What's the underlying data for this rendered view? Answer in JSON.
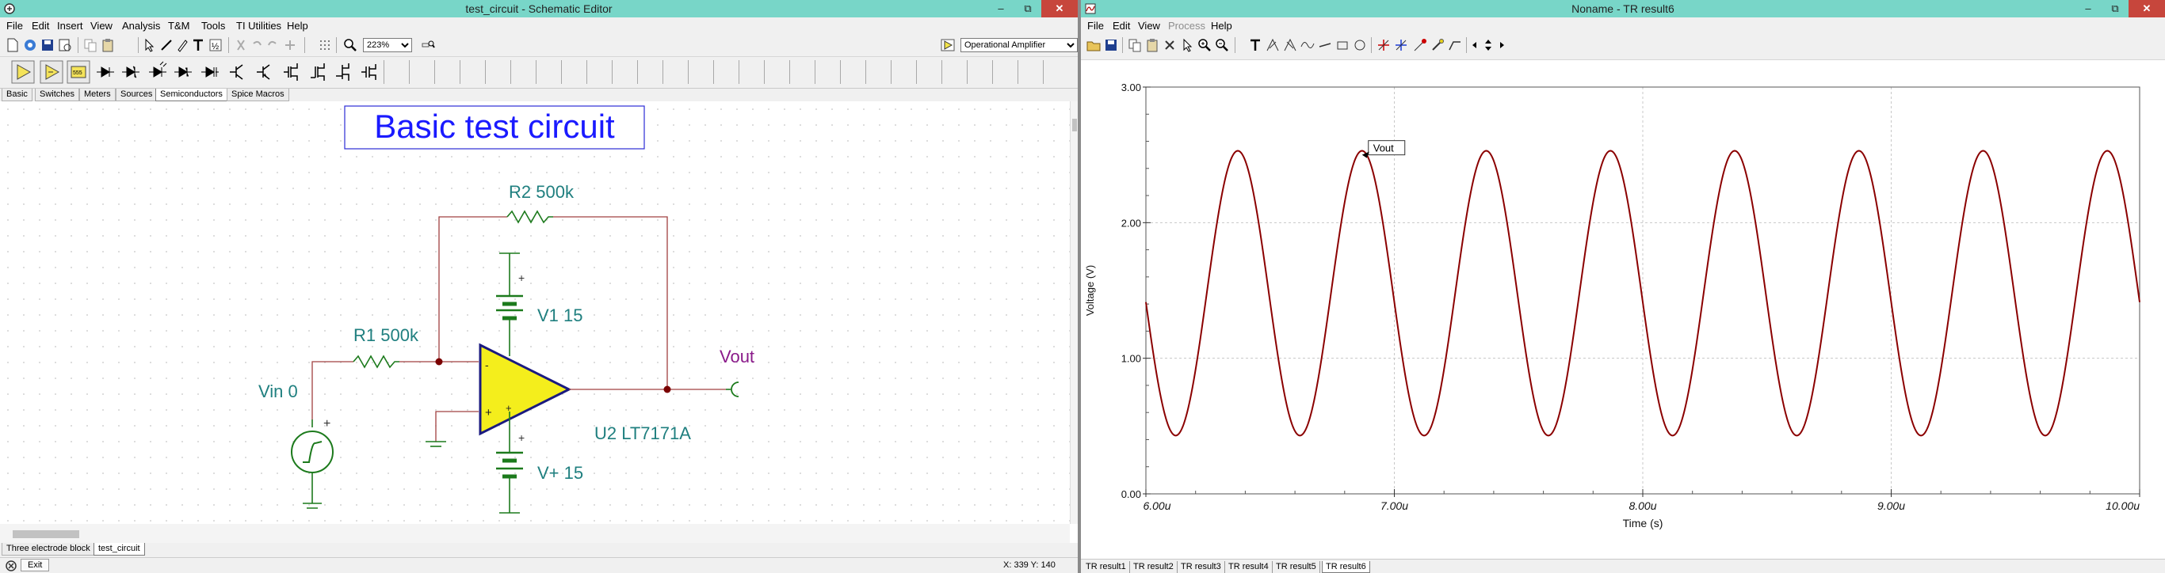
{
  "left": {
    "title": "test_circuit - Schematic Editor",
    "menu": [
      "File",
      "Edit",
      "Insert",
      "View",
      "Analysis",
      "T&M",
      "Tools",
      "TI Utilities",
      "Help"
    ],
    "zoom": "223%",
    "part_selector": "Operational Amplifier",
    "part_tabs": [
      "Basic",
      "Switches",
      "Meters",
      "Sources",
      "Semiconductors",
      "Spice Macros"
    ],
    "active_part_tab": "Semiconductors",
    "schematic": {
      "title": "Basic test circuit",
      "r2": "R2 500k",
      "r1": "R1 500k",
      "v1": "V1 15",
      "vplus": "V+ 15",
      "vin": "Vin 0",
      "vout": "Vout",
      "u2": "U2 LT7171A",
      "plus": "+",
      "minus": "-"
    },
    "doc_tabs": [
      "Three electrode block",
      "test_circuit"
    ],
    "status": {
      "exit_label": "Exit",
      "coords": "X: 339 Y: 140"
    }
  },
  "right": {
    "title": "Noname - TR result6",
    "menu": [
      "File",
      "Edit",
      "View",
      "Process",
      "Help"
    ],
    "menu_disabled": [
      "Process"
    ],
    "result_tabs": [
      "TR result1",
      "TR result2",
      "TR result3",
      "TR result4",
      "TR result5",
      "TR result6"
    ],
    "active_result_tab": "TR result6"
  },
  "window_controls": {
    "minimize": "–",
    "maximize": "⧉",
    "close": "✕"
  },
  "chart_data": {
    "type": "line",
    "xlabel": "Time (s)",
    "ylabel": "Voltage (V)",
    "xlim": [
      6.0,
      10.0
    ],
    "ylim": [
      0.0,
      3.0
    ],
    "x_unit_suffix": "u",
    "x_ticks": [
      "6.00u",
      "7.00u",
      "8.00u",
      "9.00u",
      "10.00u"
    ],
    "y_ticks": [
      "0.00",
      "1.00",
      "2.00",
      "3.00"
    ],
    "grid": true,
    "series": [
      {
        "name": "Vout",
        "color": "#8b0000",
        "shape": "sine",
        "period_u": 0.5,
        "min": 0.43,
        "max": 2.53,
        "start_value": 1.48,
        "first_peak_u": 6.37
      }
    ],
    "annotation": {
      "text": "Vout",
      "at_x_u": 6.87,
      "at_y": 2.5
    }
  }
}
